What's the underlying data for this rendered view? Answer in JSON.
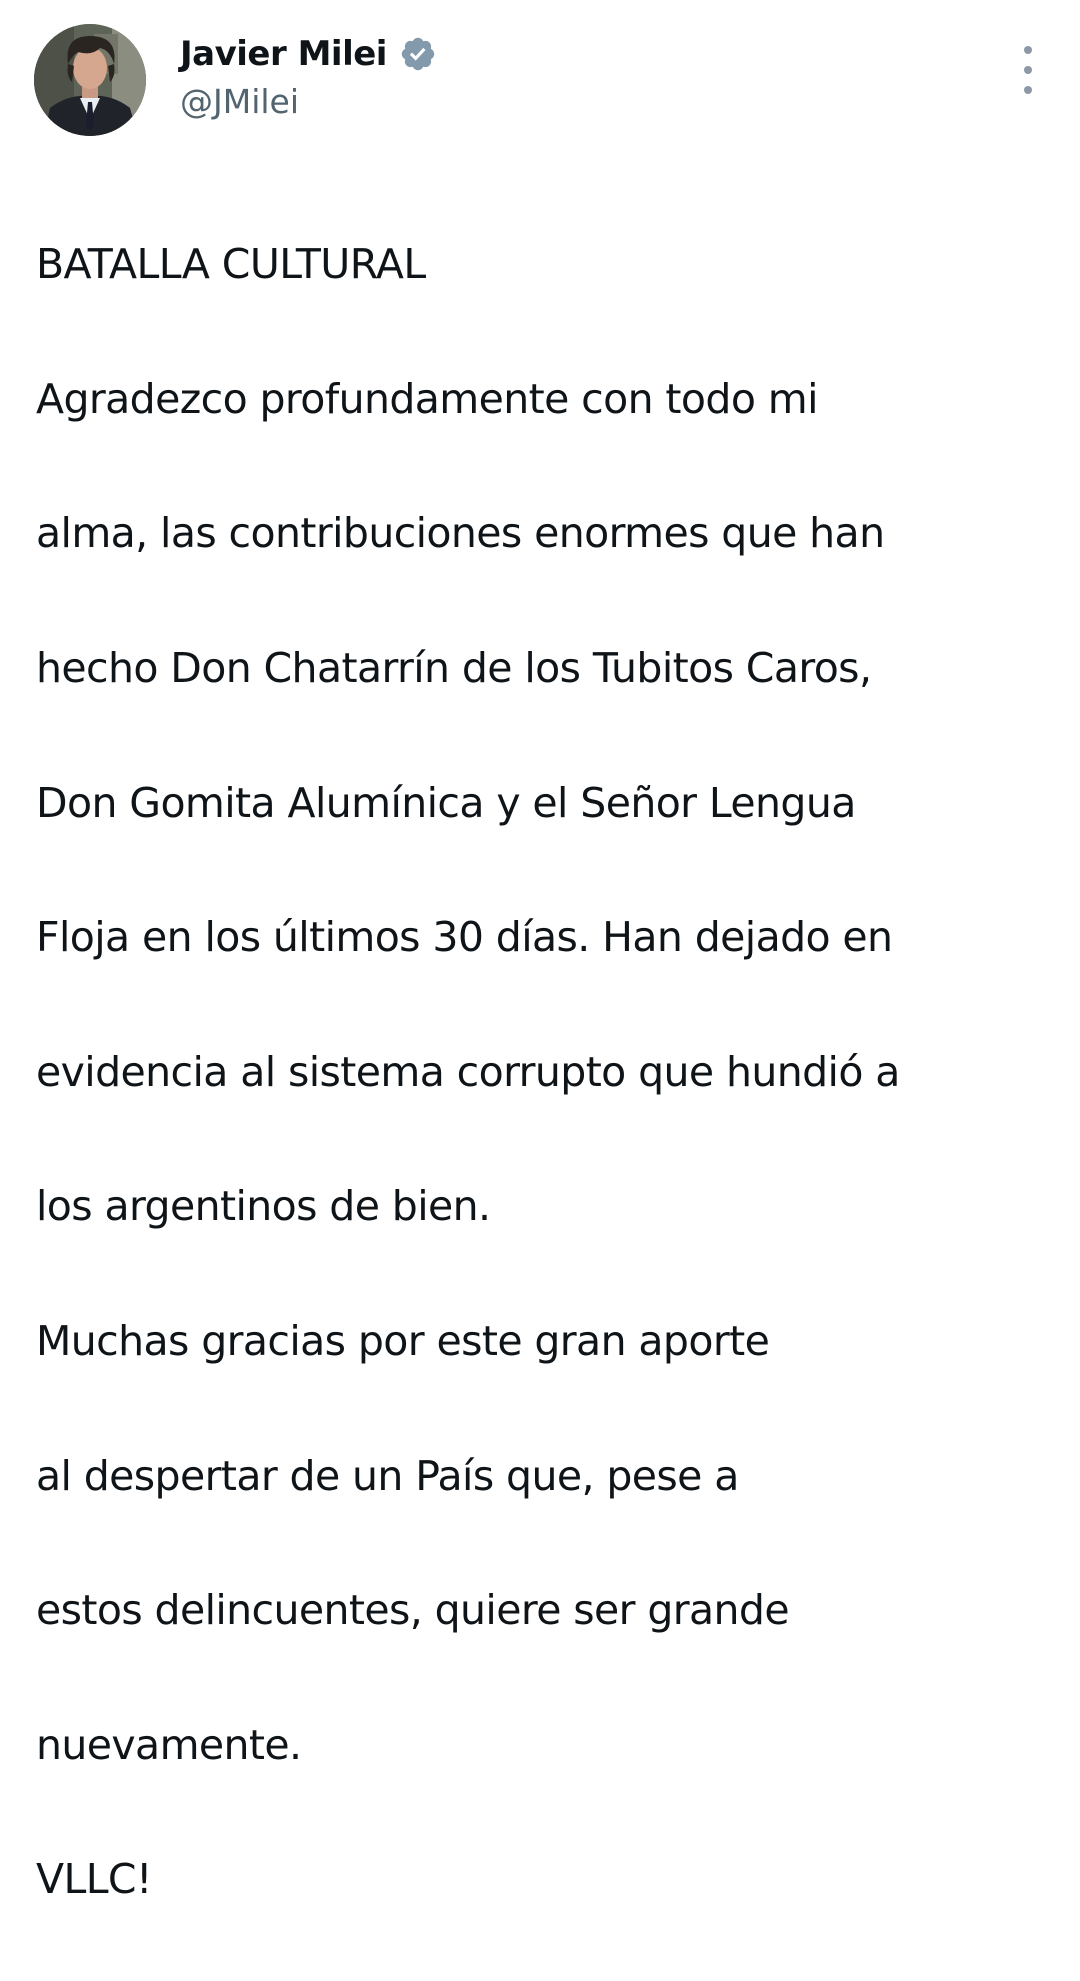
{
  "tweet": {
    "author": {
      "display_name": "Javier Milei",
      "handle": "@JMilei",
      "verified": true,
      "avatar_icon": "profile-photo"
    },
    "more_icon": "vertical-ellipsis-icon",
    "colors": {
      "text": "#0f1419",
      "secondary_text": "#536471",
      "verified_badge": "#829aab",
      "background": "#ffffff"
    },
    "lines": [
      "BATALLA CULTURAL",
      "Agradezco profundamente con todo mi",
      "alma, las contribuciones enormes que han",
      "hecho Don Chatarrín de los Tubitos Caros,",
      "Don Gomita Alumínica y el Señor Lengua",
      "Floja en los últimos 30 días. Han dejado en",
      "evidencia al sistema corrupto que hundió a",
      "los argentinos de bien.",
      "Muchas gracias por este gran aporte",
      "al despertar de un País que, pese a",
      "estos delincuentes, quiere ser grande",
      "nuevamente.",
      "VLLC!"
    ]
  }
}
